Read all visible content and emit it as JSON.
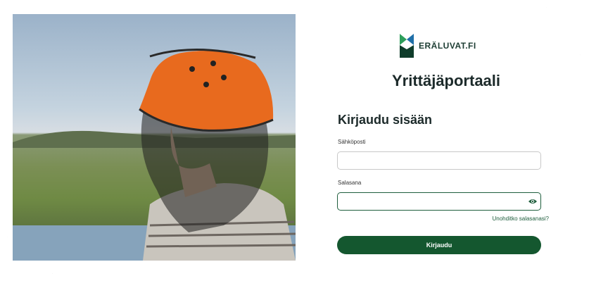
{
  "brand": {
    "name": "ERÄLUVAT.FI",
    "logo_icon": "eraluvat-logo-icon",
    "logo_colors": [
      "#2e9e5b",
      "#1f6fa8",
      "#0f3d2b"
    ]
  },
  "portal": {
    "title": "Yrittäjäportaali"
  },
  "login": {
    "heading": "Kirjaudu sisään",
    "email_label": "Sähköposti",
    "email_value": "",
    "password_label": "Salasana",
    "password_value": "",
    "show_password_icon": "eye-icon",
    "forgot_link": "Unohditko salasanasi?",
    "submit_label": "Kirjaudu"
  },
  "colors": {
    "accent": "#14572f",
    "title_text": "#1c2a2a",
    "link": "#1f5e3d"
  },
  "photo": {
    "subject": "person-in-orange-hat-with-mosquito-net"
  }
}
